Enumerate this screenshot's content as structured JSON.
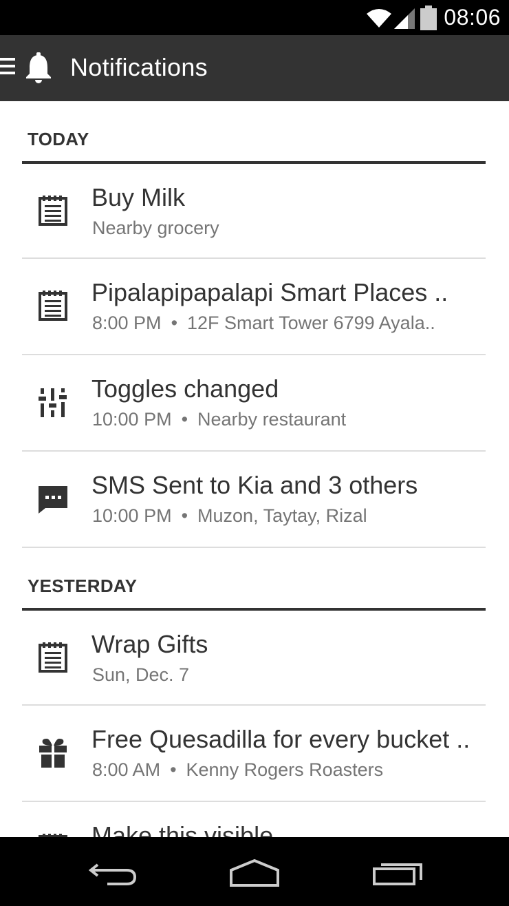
{
  "status_bar": {
    "time": "08:06",
    "icons": [
      "wifi-icon",
      "signal-icon",
      "battery-icon"
    ]
  },
  "app_bar": {
    "title": "Notifications",
    "icons": [
      "menu-icon",
      "bell-icon"
    ]
  },
  "sections": [
    {
      "header": "TODAY",
      "items": [
        {
          "icon": "notepad-icon",
          "title": "Buy Milk",
          "time": "",
          "detail": "Nearby grocery"
        },
        {
          "icon": "notepad-icon",
          "title": "Pipalapipapalapi Smart Places ..",
          "time": "8:00 PM",
          "detail": "12F Smart Tower 6799 Ayala.."
        },
        {
          "icon": "toggles-icon",
          "title": "Toggles changed",
          "time": "10:00 PM",
          "detail": "Nearby restaurant"
        },
        {
          "icon": "sms-icon",
          "title": "SMS Sent to Kia and 3 others",
          "time": "10:00 PM",
          "detail": "Muzon, Taytay, Rizal"
        }
      ]
    },
    {
      "header": "YESTERDAY",
      "items": [
        {
          "icon": "notepad-icon",
          "title": "Wrap Gifts",
          "time": "",
          "detail": "Sun, Dec. 7"
        },
        {
          "icon": "gift-icon",
          "title": "Free Quesadilla for every bucket ..",
          "time": "8:00 AM",
          "detail": "Kenny Rogers Roasters"
        },
        {
          "icon": "notepad-icon",
          "title": "Make this visible",
          "time": "",
          "detail": ""
        }
      ]
    }
  ],
  "separator": "•",
  "nav_bar": {
    "icons": [
      "back-icon",
      "home-icon",
      "recent-apps-icon"
    ]
  },
  "colors": {
    "status_bar_bg": "#000000",
    "app_bar_bg": "#333333",
    "text_primary": "#333333",
    "text_secondary": "#757575",
    "divider": "#dddddd"
  }
}
